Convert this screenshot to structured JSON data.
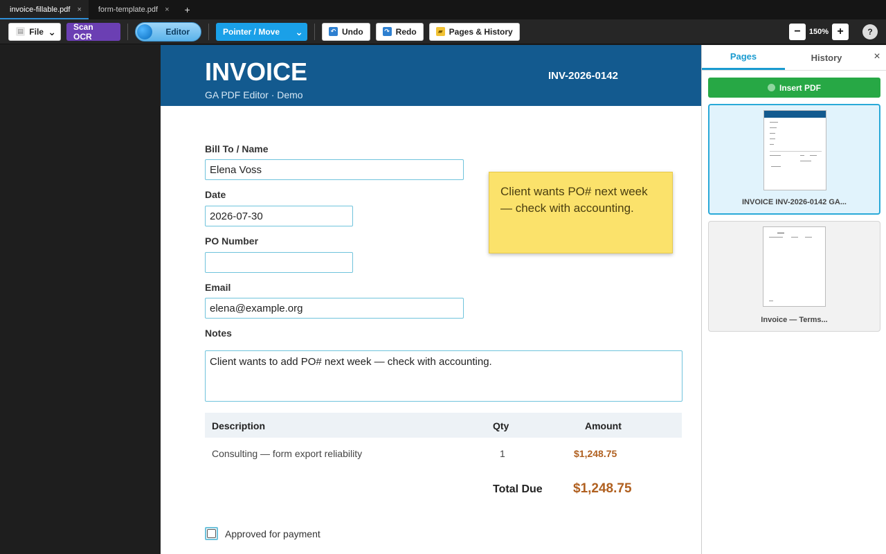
{
  "tabs": [
    {
      "label": "invoice-fillable.pdf",
      "close": "×"
    },
    {
      "label": "form-template.pdf",
      "close": "×"
    }
  ],
  "tab_add": "+",
  "toolbar": {
    "file_label": "File",
    "file_caret": "⌄",
    "ocr_label": "Scan OCR",
    "editor_toggle": "Editor",
    "mode_label": "Pointer / Move",
    "mode_caret": "⌄",
    "undo_label": "Undo",
    "redo_label": "Redo",
    "pages_history_label": "Pages & History",
    "zoom_out": "−",
    "zoom_value": "150%",
    "zoom_in": "+",
    "help": "?"
  },
  "invoice": {
    "title": "INVOICE",
    "subtitle": "GA PDF Editor · Demo",
    "number": "INV-2026-0142",
    "fields": {
      "bill_to_label": "Bill To / Name",
      "bill_to_value": "Elena Voss",
      "date_label": "Date",
      "date_value": "2026-07-30",
      "po_label": "PO Number",
      "po_value": "",
      "email_label": "Email",
      "email_value": "elena@example.org",
      "notes_label": "Notes",
      "notes_value": "Client wants to add PO# next week — check with accounting."
    },
    "sticky_note": "Client wants PO# next week — check with accounting.",
    "table": {
      "headers": [
        "Description",
        "Qty",
        "Amount"
      ],
      "rows": [
        {
          "description": "Consulting — form export reliability",
          "qty": "1",
          "amount": "$1,248.75"
        }
      ]
    },
    "total_label": "Total Due",
    "total_value": "$1,248.75",
    "approved_label": "Approved for payment"
  },
  "panel": {
    "tab_pages": "Pages",
    "tab_history": "History",
    "close": "×",
    "insert_label": "Insert PDF",
    "thumbnails": [
      {
        "caption": "INVOICE INV-2026-0142 GA..."
      },
      {
        "caption": "Invoice — Terms..."
      }
    ]
  },
  "colors": {
    "header_blue": "#135a8f",
    "accent_cyan": "#1a9bd0",
    "ocr_purple": "#6b3fb3",
    "insert_green": "#27a845",
    "amount_orange": "#b06020",
    "sticky_yellow": "#fbe26b"
  }
}
